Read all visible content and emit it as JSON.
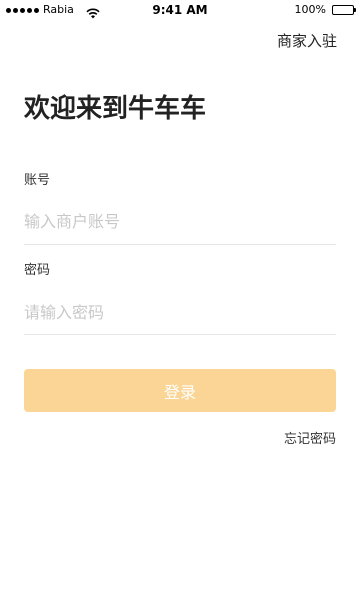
{
  "status_bar": {
    "carrier": "Rabia",
    "time": "9:41 AM",
    "battery": "100%",
    "battery_level": 1.0,
    "signal_icon": "signal-dots-icon",
    "wifi_icon": "wifi-icon",
    "battery_icon": "battery-icon"
  },
  "header": {
    "merchant_link": "商家入驻"
  },
  "main": {
    "welcome_title": "欢迎来到牛车车",
    "account": {
      "label": "账号",
      "value": "",
      "placeholder": "输入商户账号"
    },
    "password": {
      "label": "密码",
      "value": "",
      "placeholder": "请输入密码"
    },
    "login_button": "登录",
    "forgot_password": "忘记密码"
  },
  "colors": {
    "button_bg": "#fad596",
    "button_text": "#ffffff",
    "placeholder": "#c8c8c8",
    "divider": "#e6e6e6"
  }
}
